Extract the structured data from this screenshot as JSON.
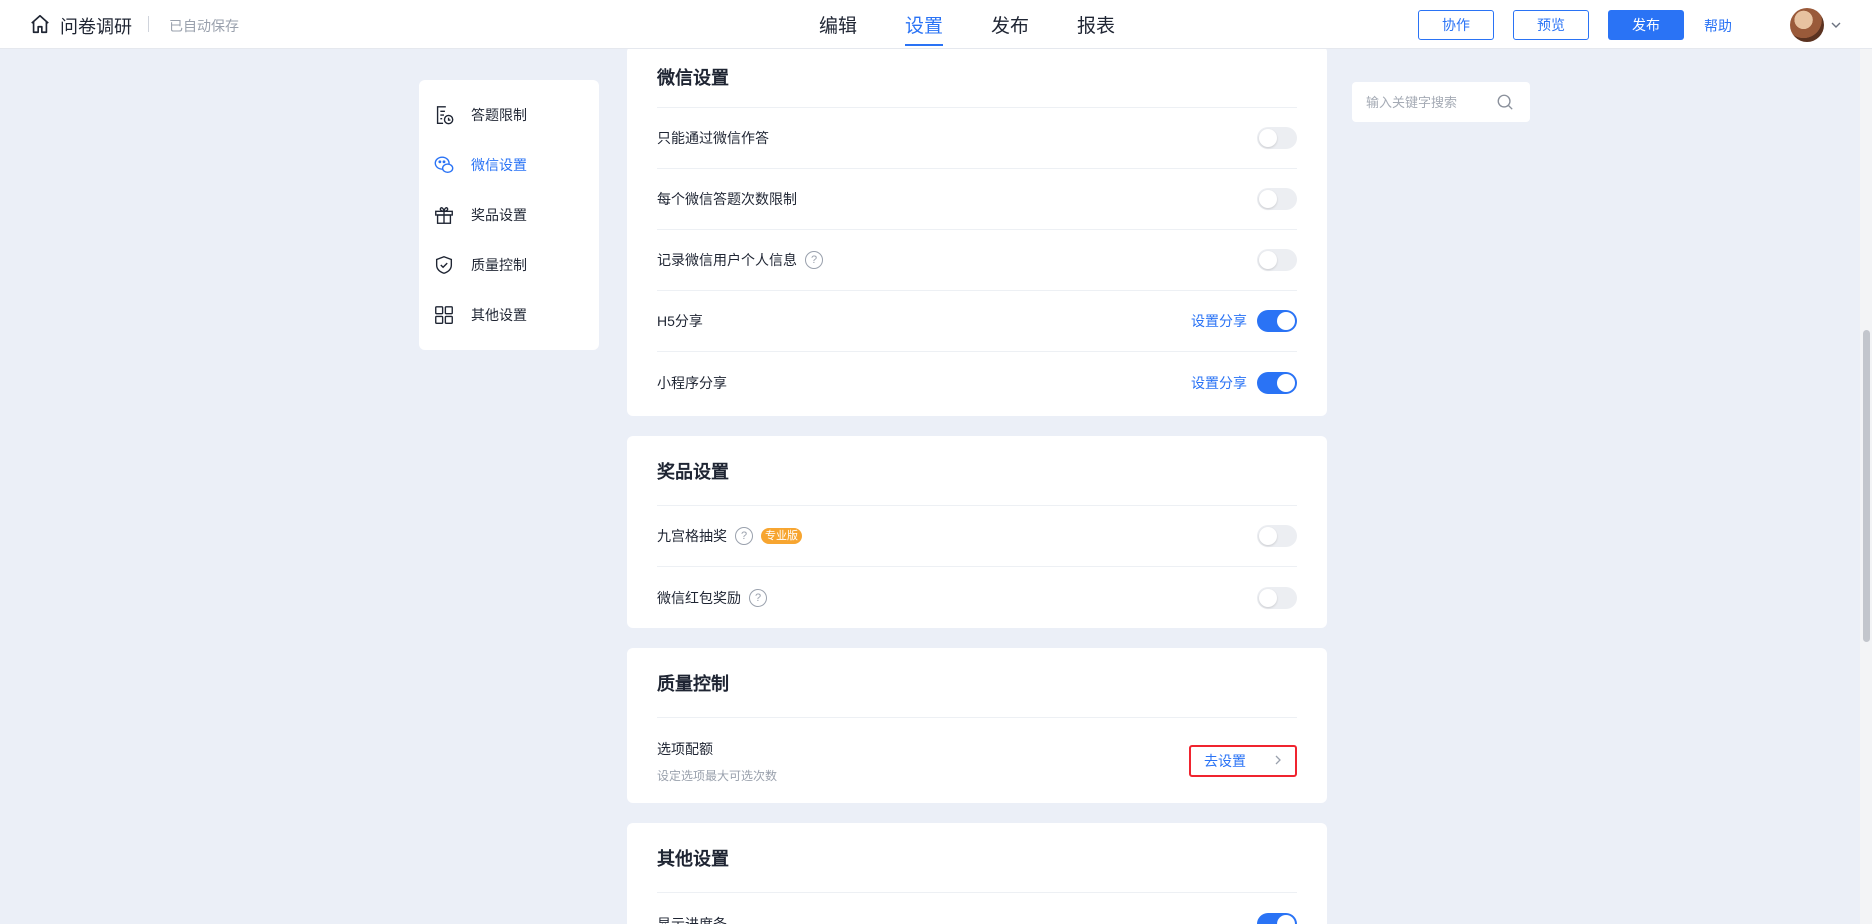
{
  "header": {
    "app_title": "问卷调研",
    "autosave": "已自动保存",
    "tabs": [
      {
        "label": "编辑",
        "active": false
      },
      {
        "label": "设置",
        "active": true
      },
      {
        "label": "发布",
        "active": false
      },
      {
        "label": "报表",
        "active": false
      }
    ],
    "collab_label": "协作",
    "preview_label": "预览",
    "publish_label": "发布",
    "help_label": "帮助"
  },
  "sidebar": {
    "items": [
      {
        "label": "答题限制",
        "icon": "answer-limit-icon",
        "active": false
      },
      {
        "label": "微信设置",
        "icon": "wechat-icon",
        "active": true
      },
      {
        "label": "奖品设置",
        "icon": "gift-icon",
        "active": false
      },
      {
        "label": "质量控制",
        "icon": "shield-icon",
        "active": false
      },
      {
        "label": "其他设置",
        "icon": "grid-icon",
        "active": false
      }
    ]
  },
  "search": {
    "placeholder": "输入关键字搜索"
  },
  "wechat": {
    "title": "微信设置",
    "rows": [
      {
        "label": "只能通过微信作答",
        "on": false
      },
      {
        "label": "每个微信答题次数限制",
        "on": false
      },
      {
        "label": "记录微信用户个人信息",
        "help": "?",
        "on": false
      },
      {
        "label": "H5分享",
        "link": "设置分享",
        "on": true
      },
      {
        "label": "小程序分享",
        "link": "设置分享",
        "on": true
      }
    ]
  },
  "prize": {
    "title": "奖品设置",
    "rows": [
      {
        "label": "九宫格抽奖",
        "help": "?",
        "badge": "专业版",
        "on": false
      },
      {
        "label": "微信红包奖励",
        "help": "?",
        "on": false
      }
    ]
  },
  "quality": {
    "title": "质量控制",
    "quota_label": "选项配额",
    "quota_sub": "设定选项最大可选次数",
    "goto_label": "去设置"
  },
  "other": {
    "title": "其他设置",
    "rows": [
      {
        "label": "显示进度条",
        "on": true
      }
    ]
  },
  "colors": {
    "accent": "#2a73f5",
    "highlight": "#f0242f",
    "badge": "#f7a530",
    "background": "#ebeff7"
  }
}
